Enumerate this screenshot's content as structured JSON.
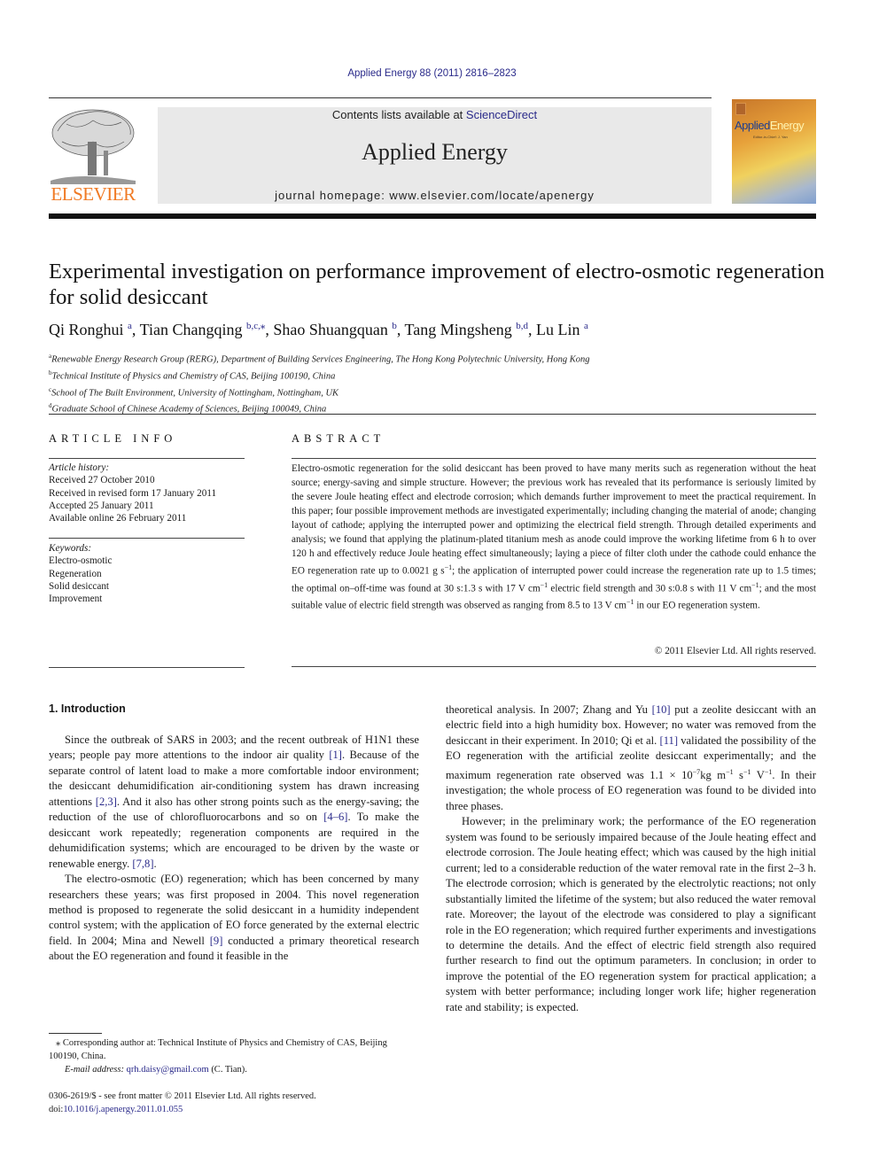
{
  "header": {
    "journal_ref": "Applied Energy 88 (2011) 2816–2823",
    "contents_prefix": "Contents lists available at ",
    "contents_link": "ScienceDirect",
    "journal_name": "Applied Energy",
    "homepage": "journal homepage: www.elsevier.com/locate/apenergy",
    "publisher_logo_text": "ELSEVIER",
    "cover_title_a": "Applied",
    "cover_title_b": "Energy",
    "cover_subtitle": "Editor-in-Chief: J. Yan"
  },
  "article": {
    "title": "Experimental investigation on performance improvement of electro-osmotic regeneration for solid desiccant",
    "authors": [
      {
        "name": "Qi Ronghui",
        "sup": "a"
      },
      {
        "name": "Tian Changqing",
        "sup": "b,c,⁎"
      },
      {
        "name": "Shao Shuangquan",
        "sup": "b"
      },
      {
        "name": "Tang Mingsheng",
        "sup": "b,d"
      },
      {
        "name": "Lu Lin",
        "sup": "a"
      }
    ],
    "affiliations": [
      {
        "key": "a",
        "text": "Renewable Energy Research Group (RERG), Department of Building Services Engineering, The Hong Kong Polytechnic University, Hong Kong"
      },
      {
        "key": "b",
        "text": "Technical Institute of Physics and Chemistry of CAS, Beijing 100190, China"
      },
      {
        "key": "c",
        "text": "School of The Built Environment, University of Nottingham, Nottingham, UK"
      },
      {
        "key": "d",
        "text": "Graduate School of Chinese Academy of Sciences, Beijing 100049, China"
      }
    ]
  },
  "article_info": {
    "heading": "ARTICLE INFO",
    "history_label": "Article history:",
    "history": [
      "Received 27 October 2010",
      "Received in revised form 17 January 2011",
      "Accepted 25 January 2011",
      "Available online 26 February 2011"
    ],
    "keywords_label": "Keywords:",
    "keywords": [
      "Electro-osmotic",
      "Regeneration",
      "Solid desiccant",
      "Improvement"
    ]
  },
  "abstract": {
    "heading": "ABSTRACT",
    "text_1": "Electro-osmotic regeneration for the solid desiccant has been proved to have many merits such as regeneration without the heat source; energy-saving and simple structure. However; the previous work has revealed that its performance is seriously limited by the severe Joule heating effect and electrode corrosion; which demands further improvement to meet the practical requirement. In this paper; four possible improvement methods are investigated experimentally; including changing the material of anode; changing layout of cathode; applying the interrupted power and optimizing the electrical field strength. Through detailed experiments and analysis; we found that applying the platinum-plated titanium mesh as anode could improve the working lifetime from 6 h to over 120 h and effectively reduce Joule heating effect simultaneously; laying a piece of filter cloth under the cathode could enhance the EO regeneration rate up to 0.0021 g s",
    "sup_1": "−1",
    "text_2": "; the application of interrupted power could increase the regeneration rate up to 1.5 times; the optimal on–off-time was found at 30 s:1.3 s with 17 V cm",
    "sup_2": "−1",
    "text_3": " electric field strength and 30 s:0.8 s with 11 V cm",
    "sup_3": "−1",
    "text_4": "; and the most suitable value of electric field strength was observed as ranging from 8.5 to 13 V cm",
    "sup_4": "−1",
    "text_5": " in our EO regeneration system.",
    "copyright": "© 2011 Elsevier Ltd. All rights reserved."
  },
  "body": {
    "section_heading": "1. Introduction",
    "left": {
      "p1_a": "Since the outbreak of SARS in 2003; and the recent outbreak of H1N1 these years; people pay more attentions to the indoor air quality ",
      "p1_ref1": "[1]",
      "p1_b": ". Because of the separate control of latent load to make a more comfortable indoor environment; the desiccant dehumidification air-conditioning system has drawn increasing attentions ",
      "p1_ref2": "[2,3]",
      "p1_c": ". And it also has other strong points such as the energy-saving; the reduction of the use of chlorofluorocarbons and so on ",
      "p1_ref3": "[4–6]",
      "p1_d": ". To make the desiccant work repeatedly; regeneration components are required in the dehumidification systems; which are encouraged to be driven by the waste or renewable energy. ",
      "p1_ref4": "[7,8]",
      "p1_e": ".",
      "p2_a": "The electro-osmotic (EO) regeneration; which has been concerned by many researchers these years; was first proposed in 2004. This novel regeneration method is proposed to regenerate the solid desiccant in a humidity independent control system; with the application of EO force generated by the external electric field. In 2004; Mina and Newell ",
      "p2_ref1": "[9]",
      "p2_b": " conducted a primary theoretical research about the EO regeneration and found it feasible in the"
    },
    "right": {
      "p1_a": "theoretical analysis. In 2007; Zhang and Yu ",
      "p1_ref1": "[10]",
      "p1_b": " put a zeolite desiccant with an electric field into a high humidity box. However; no water was removed from the desiccant in their experiment. In 2010; Qi et al. ",
      "p1_ref2": "[11]",
      "p1_c": " validated the possibility of the EO regeneration with the artificial zeolite desiccant experimentally; and the maximum regeneration rate observed was 1.1 × 10",
      "p1_sup1": "−7",
      "p1_d": "kg m",
      "p1_sup2": "−1",
      "p1_e": " s",
      "p1_sup3": "−1",
      "p1_f": " V",
      "p1_sup4": "−1",
      "p1_g": ". In their investigation; the whole process of EO regeneration was found to be divided into three phases.",
      "p2": "However; in the preliminary work; the performance of the EO regeneration system was found to be seriously impaired because of the Joule heating effect and electrode corrosion. The Joule heating effect; which was caused by the high initial current; led to a considerable reduction of the water removal rate in the first 2–3 h. The electrode corrosion; which is generated by the electrolytic reactions; not only substantially limited the lifetime of the system; but also reduced the water removal rate. Moreover; the layout of the electrode was considered to play a significant role in the EO regeneration; which required further experiments and investigations to determine the details. And the effect of electric field strength also required further research to find out the optimum parameters. In conclusion; in order to improve the potential of the EO regeneration system for practical application; a system with better performance; including longer work life; higher regeneration rate and stability; is expected."
    }
  },
  "footnotes": {
    "corresponding_mark": "⁎",
    "corresponding": " Corresponding author at: Technical Institute of Physics and Chemistry of CAS, Beijing 100190, China.",
    "email_label": "E-mail address:",
    "email": "qrh.daisy@gmail.com",
    "email_owner": " (C. Tian).",
    "issn_line": "0306-2619/$ - see front matter © 2011 Elsevier Ltd. All rights reserved.",
    "doi_label": "doi:",
    "doi": "10.1016/j.apenergy.2011.01.055"
  }
}
